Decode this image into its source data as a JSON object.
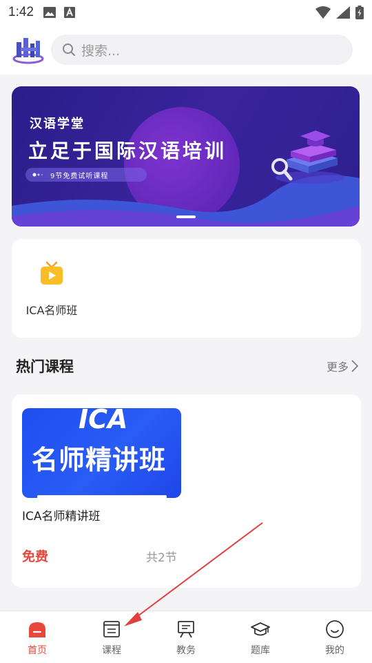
{
  "status_bar": {
    "time": "1:42"
  },
  "header": {
    "search_placeholder": "搜索..."
  },
  "banner": {
    "subtitle": "汉语学堂",
    "title": "立足于国际汉语培训",
    "pill_text": "9节免费试听课程"
  },
  "categories": [
    {
      "label": "ICA名师班",
      "icon": "tv-icon"
    }
  ],
  "section": {
    "title": "热门课程",
    "more": "更多"
  },
  "course": {
    "thumb_top": "ICA",
    "thumb_main": "名师精讲班",
    "name": "ICA名师精讲班",
    "price": "免费",
    "lessons": "共2节"
  },
  "bottom_nav": [
    {
      "label": "首页",
      "icon": "home-icon",
      "active": true
    },
    {
      "label": "课程",
      "icon": "course-icon",
      "active": false
    },
    {
      "label": "教务",
      "icon": "board-icon",
      "active": false
    },
    {
      "label": "题库",
      "icon": "graduation-cap-icon",
      "active": false
    },
    {
      "label": "我的",
      "icon": "smile-icon",
      "active": false
    }
  ],
  "colors": {
    "accent": "#e8473b",
    "banner": "#2a1d8a",
    "course_blue": "#1f4ef0"
  }
}
